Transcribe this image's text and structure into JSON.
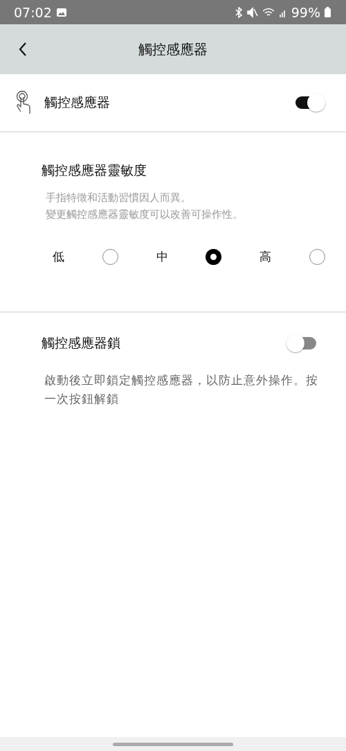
{
  "status_bar": {
    "time": "07:02",
    "battery": "99%"
  },
  "header": {
    "title": "觸控感應器"
  },
  "touch_sensor": {
    "label": "觸控感應器",
    "on": true
  },
  "sensitivity": {
    "title": "觸控感應器靈敏度",
    "description": [
      "手指特徵和活動習慣因人而異。",
      "變更觸控感應器靈敏度可以改善可操作性。"
    ],
    "options": [
      {
        "label": "低",
        "selected": false
      },
      {
        "label": "中",
        "selected": true
      },
      {
        "label": "高",
        "selected": false
      }
    ]
  },
  "lock": {
    "label": "觸控感應器鎖",
    "on": false,
    "description": "啟動後立即鎖定觸控感應器，以防止意外操作。按一次按鈕解鎖"
  }
}
